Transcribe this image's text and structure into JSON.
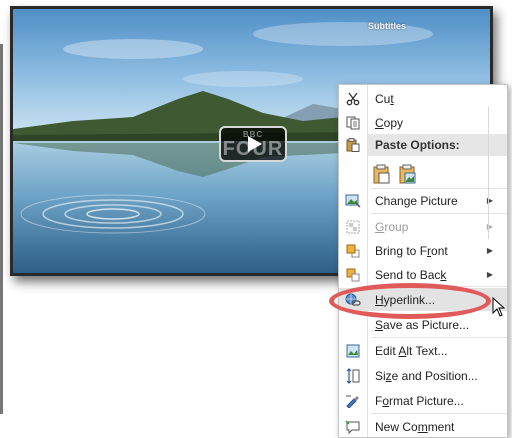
{
  "video": {
    "subtitles_label": "Subtitles",
    "logo_line1": "BBC",
    "logo_line2": "FOUR"
  },
  "menu": {
    "items": [
      {
        "pre": "Cu",
        "acc": "t",
        "post": "",
        "icon": "scissors-icon",
        "enabled": true,
        "submenu": false
      },
      {
        "pre": "",
        "acc": "C",
        "post": "opy",
        "icon": "copy-icon",
        "enabled": true,
        "submenu": false
      },
      {
        "pre": "Chan",
        "acc": "g",
        "post": "e Picture",
        "icon": "change-picture-icon",
        "enabled": true,
        "submenu": true
      },
      {
        "pre": "",
        "acc": "G",
        "post": "roup",
        "icon": "group-icon",
        "enabled": false,
        "submenu": true
      },
      {
        "pre": "Bring to F",
        "acc": "r",
        "post": "ont",
        "icon": "bring-to-front-icon",
        "enabled": true,
        "submenu": true
      },
      {
        "pre": "Send to Bac",
        "acc": "k",
        "post": "",
        "icon": "send-to-back-icon",
        "enabled": true,
        "submenu": true
      },
      {
        "pre": "",
        "acc": "H",
        "post": "yperlink...",
        "icon": "hyperlink-icon",
        "enabled": true,
        "submenu": false
      },
      {
        "pre": "",
        "acc": "S",
        "post": "ave as Picture...",
        "icon": "",
        "enabled": true,
        "submenu": false
      },
      {
        "pre": "Edit ",
        "acc": "A",
        "post": "lt Text...",
        "icon": "alt-text-icon",
        "enabled": true,
        "submenu": false
      },
      {
        "pre": "Si",
        "acc": "z",
        "post": "e and Position...",
        "icon": "size-position-icon",
        "enabled": true,
        "submenu": false
      },
      {
        "pre": "F",
        "acc": "o",
        "post": "rmat Picture...",
        "icon": "format-picture-icon",
        "enabled": true,
        "submenu": false
      },
      {
        "pre": "New Co",
        "acc": "m",
        "post": "ment",
        "icon": "new-comment-icon",
        "enabled": true,
        "submenu": false
      }
    ],
    "paste_options_label": "Paste Options:",
    "highlighted_item": "Hyperlink...",
    "highlight_color": "#e05a5a"
  }
}
